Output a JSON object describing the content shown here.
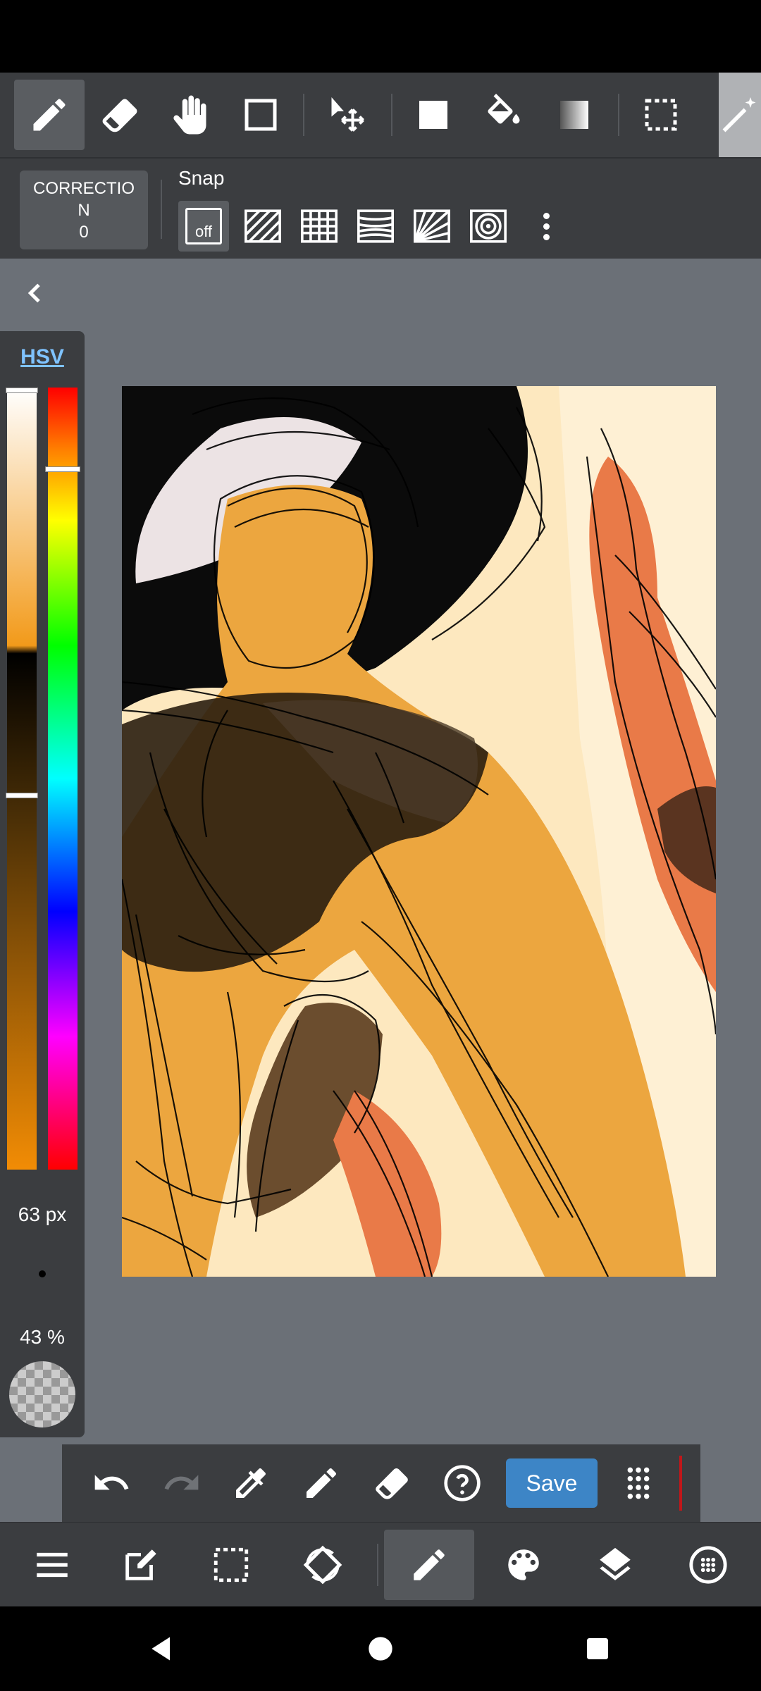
{
  "toolbar": {
    "tools": [
      {
        "name": "pen-icon",
        "active": true
      },
      {
        "name": "eraser-icon"
      },
      {
        "name": "hand-icon"
      },
      {
        "name": "rectangle-shape-icon"
      },
      {
        "name": "move-icon"
      },
      {
        "name": "fill-square-icon"
      },
      {
        "name": "bucket-icon"
      },
      {
        "name": "gradient-icon"
      },
      {
        "name": "select-icon"
      },
      {
        "name": "magic-wand-icon"
      }
    ]
  },
  "correction": {
    "label": "CORRECTIO\nN",
    "value": "0"
  },
  "snap": {
    "label": "Snap",
    "off_label": "off",
    "modes": [
      "snap-off",
      "snap-parallel",
      "snap-grid",
      "snap-perspective-lines",
      "snap-radial",
      "snap-concentric"
    ]
  },
  "color_panel": {
    "mode_label": "HSV",
    "brush_size": "63 px",
    "opacity": "43 %",
    "current_color": "#f29a1a"
  },
  "quick_bar": {
    "save_label": "Save",
    "buttons": [
      "undo-icon",
      "redo-icon",
      "eyedropper-icon",
      "pen-icon",
      "eraser-icon",
      "help-icon",
      "save",
      "grid-menu-icon"
    ]
  },
  "bottom_bar": {
    "buttons": [
      "menu-icon",
      "edit-icon",
      "selection-icon",
      "transform-icon",
      "brush-icon",
      "palette-icon",
      "layers-icon",
      "settings-icon"
    ],
    "active": "brush-icon"
  },
  "colors": {
    "toolbar_bg": "#3b3d40",
    "workspace_bg": "#6b7077",
    "accent": "#3d85c6"
  }
}
